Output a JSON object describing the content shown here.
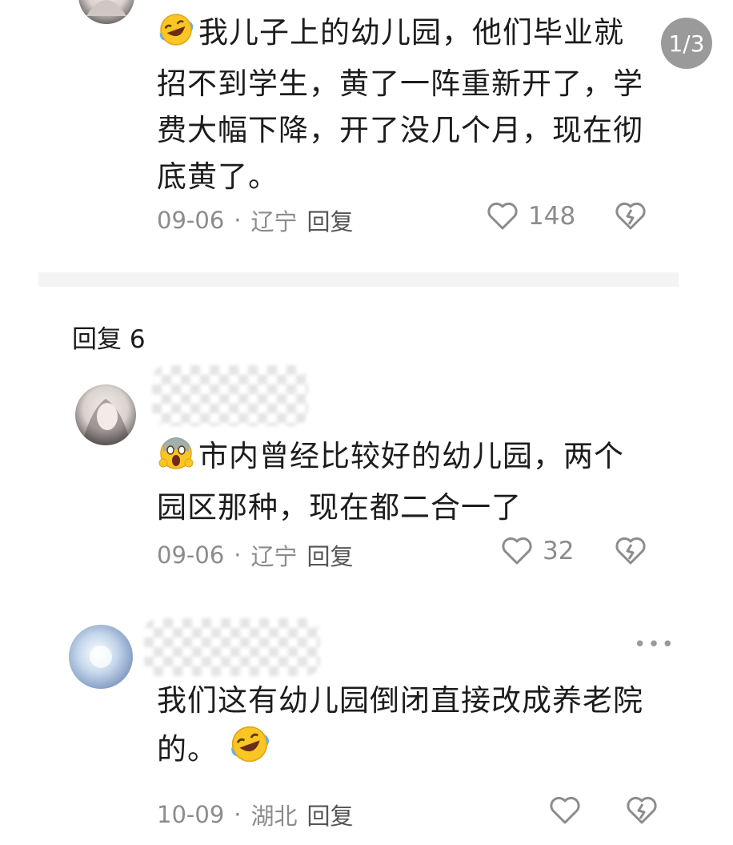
{
  "pager": {
    "label": "1/3"
  },
  "comments_top": {
    "text": "我儿子上的幼儿园，他们毕业就招不到学生，黄了一阵重新开了，学费大幅下降，开了没几个月，现在彻底黄了。",
    "emoji": "laughing-crying-face",
    "date": "09-06",
    "location": "辽宁",
    "reply_label": "回复",
    "likes": "148"
  },
  "replies_section": {
    "title": "回复 6"
  },
  "reply_1": {
    "emoji": "screaming-face",
    "text": "市内曾经比较好的幼儿园，两个园区那种，现在都二合一了",
    "date": "09-06",
    "location": "辽宁",
    "reply_label": "回复",
    "likes": "32"
  },
  "reply_2": {
    "text_line1": "我们这有幼儿园倒闭直接改成养老院",
    "text_line2": "的。",
    "emoji": "laughing-crying-face",
    "date": "10-09",
    "location": "湖北",
    "reply_label": "回复",
    "likes": ""
  },
  "colors": {
    "text": "#1c1c1c",
    "meta": "#8c8c8c",
    "badge": "#9a9a9a",
    "divider": "#f4f4f4"
  }
}
